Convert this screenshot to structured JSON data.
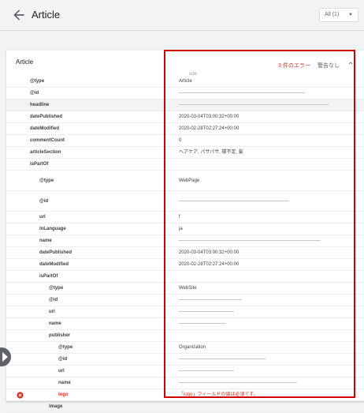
{
  "header": {
    "title": "Article",
    "filter_label": "All (1)"
  },
  "card": {
    "title": "Article",
    "errors_label": "3 件のエラー",
    "warnings_label": "警告なし",
    "top_hint": "ude"
  },
  "rows": [
    {
      "key": "@type",
      "value": "Article",
      "indent": 1
    },
    {
      "key": "@id",
      "value": "",
      "indent": 1,
      "redacted": 160
    },
    {
      "key": "headline",
      "value": "",
      "indent": 1,
      "redacted": 190,
      "highlight": true
    },
    {
      "key": "datePublished",
      "value": "2020-03-04T03:00:32+00:00",
      "indent": 1
    },
    {
      "key": "dateModified",
      "value": "2020-02-28T02:27:24+00:00",
      "indent": 1
    },
    {
      "key": "commentCount",
      "value": "0",
      "indent": 1
    },
    {
      "key": "articleSection",
      "value": "ヘアケア, パサパサ, 寝不足, 髪",
      "indent": 1
    },
    {
      "key": "isPartOf",
      "value": "",
      "indent": 1
    },
    {
      "key": "@type",
      "value": "WebPage",
      "indent": 2,
      "tall": true
    },
    {
      "key": "@id",
      "value": "",
      "indent": 2,
      "tall": true,
      "redacted": 140
    },
    {
      "key": "url",
      "value": "f",
      "indent": 2
    },
    {
      "key": "inLanguage",
      "value": "ja",
      "indent": 2
    },
    {
      "key": "name",
      "value": "",
      "indent": 2,
      "redacted": 180
    },
    {
      "key": "datePublished",
      "value": "2020-03-04T03:00:32+00:00",
      "indent": 2
    },
    {
      "key": "dateModified",
      "value": "2020-02-28T02:27:24+00:00",
      "indent": 2
    },
    {
      "key": "isPartOf",
      "value": "",
      "indent": 2
    },
    {
      "key": "@type",
      "value": "WebSite",
      "indent": 3
    },
    {
      "key": "@id",
      "value": "",
      "indent": 3,
      "redacted": 80
    },
    {
      "key": "url",
      "value": "",
      "indent": 3,
      "redacted": 70
    },
    {
      "key": "name",
      "value": "",
      "indent": 3,
      "redacted": 60
    },
    {
      "key": "publisher",
      "value": "",
      "indent": 3
    },
    {
      "key": "@type",
      "value": "Organization",
      "indent": 4
    },
    {
      "key": "@id",
      "value": "",
      "indent": 4,
      "redacted": 110
    },
    {
      "key": "url",
      "value": "",
      "indent": 4,
      "redacted": 70
    },
    {
      "key": "name",
      "value": "",
      "indent": 4,
      "redacted": 150
    },
    {
      "key": "logo",
      "value": "「logo」フィールドの値は必須です。",
      "indent": 4,
      "error": true
    },
    {
      "key": "image",
      "value": "",
      "indent": 3
    }
  ],
  "colors": {
    "error": "#d93025",
    "annotation": "#d10000"
  },
  "icons": {
    "back": "arrow-left-icon",
    "collapse": "chevron-up-icon",
    "error": "error-circle-icon",
    "filter": "caret-down-icon"
  }
}
